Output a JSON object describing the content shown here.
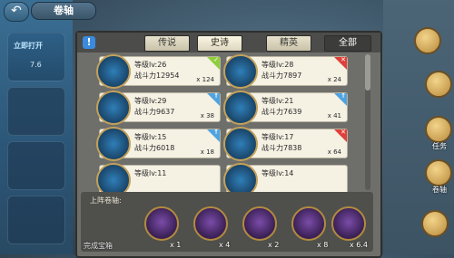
{
  "header": {
    "back_icon": "back-arrow-icon",
    "title": "卷轴"
  },
  "left_panel": {
    "badge_text": "立即打开",
    "small_text": "7.6"
  },
  "tabs": [
    {
      "label": "传说",
      "state": "normal"
    },
    {
      "label": "史诗",
      "state": "active"
    },
    {
      "label": "精英",
      "state": "normal"
    },
    {
      "label": "全部",
      "state": "dark"
    }
  ],
  "cards": [
    {
      "level": "等级lv:26",
      "power": "战斗力12954",
      "count": "x 124",
      "corner": "green",
      "corner_mark": "✓"
    },
    {
      "level": "等级lv:28",
      "power": "战斗力7897",
      "count": "x 24",
      "corner": "red",
      "corner_mark": "✕"
    },
    {
      "level": "等级lv:29",
      "power": "战斗力9637",
      "count": "x 38",
      "corner": "blue",
      "corner_mark": "↑"
    },
    {
      "level": "等级lv:21",
      "power": "战斗力7639",
      "count": "x 41",
      "corner": "blue",
      "corner_mark": "↑"
    },
    {
      "level": "等级lv:15",
      "power": "战斗力6018",
      "count": "x 18",
      "corner": "blue",
      "corner_mark": "↑"
    },
    {
      "level": "等级lv:17",
      "power": "战斗力7838",
      "count": "x 64",
      "corner": "red",
      "corner_mark": "✕"
    },
    {
      "level": "等级lv:11",
      "power": "",
      "count": "",
      "corner": "",
      "corner_mark": ""
    },
    {
      "level": "等级lv:14",
      "power": "",
      "count": "",
      "corner": "",
      "corner_mark": ""
    }
  ],
  "bottom": {
    "label": "上阵卷轴:",
    "items": [
      {
        "count": "x 1"
      },
      {
        "count": "x 4"
      },
      {
        "count": "x 2"
      },
      {
        "count": "x 8"
      },
      {
        "count": "x 6.4"
      }
    ],
    "footer_text": "完成宝箱"
  },
  "right_side": [
    {
      "label": "任务"
    },
    {
      "label": "卷轴"
    }
  ],
  "colors": {
    "card_bg": "#f5f1e3",
    "panel_bg": "#6e6f6b",
    "green": "#8fcf3a",
    "red": "#e0403a",
    "blue": "#4fa3e0"
  }
}
